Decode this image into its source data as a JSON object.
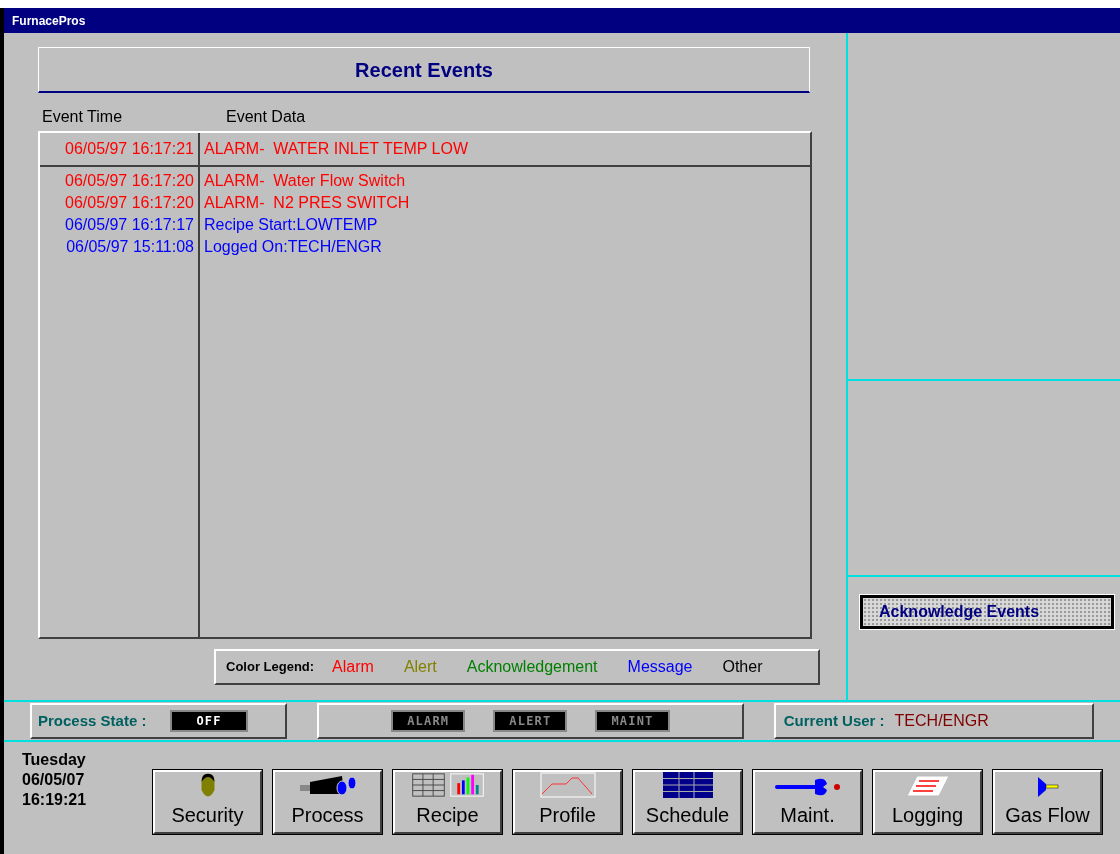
{
  "window": {
    "title": "FurnacePros"
  },
  "events_panel": {
    "title": "Recent Events",
    "columns": [
      "Event Time",
      "Event Data"
    ],
    "latest": {
      "time": "06/05/97 16:17:21",
      "data": "ALARM-  WATER INLET TEMP LOW",
      "color": "#ff0000"
    },
    "events": [
      {
        "time": "06/05/97 16:17:20",
        "data": "ALARM-  Water Flow Switch",
        "color": "#ff0000"
      },
      {
        "time": "06/05/97 16:17:20",
        "data": "ALARM-  N2 PRES SWITCH",
        "color": "#ff0000"
      },
      {
        "time": "06/05/97 16:17:17",
        "data": "Recipe Start:LOWTEMP",
        "color": "#0000ff"
      },
      {
        "time": "06/05/97 15:11:08",
        "data": "Logged On:TECH/ENGR",
        "color": "#0000ff"
      }
    ]
  },
  "legend": {
    "label": "Color Legend:",
    "items": [
      {
        "label": "Alarm",
        "color": "#ff0000"
      },
      {
        "label": "Alert",
        "color": "#808000"
      },
      {
        "label": "Acknowledgement",
        "color": "#008000"
      },
      {
        "label": "Message",
        "color": "#0000ff"
      },
      {
        "label": "Other",
        "color": "#000000"
      }
    ]
  },
  "acknowledge_button": "Acknowledge Events",
  "status": {
    "process_label": "Process State :",
    "process_state": {
      "label": "OFF",
      "active": true
    },
    "indicators": [
      {
        "label": "ALARM",
        "active": false
      },
      {
        "label": "ALERT",
        "active": false
      },
      {
        "label": "MAINT",
        "active": false
      }
    ],
    "user_label": "Current User :",
    "user": "TECH/ENGR"
  },
  "clock": {
    "day": "Tuesday",
    "date": "06/05/07",
    "time": "16:19:21"
  },
  "nav": [
    {
      "label": "Security",
      "kind": "person"
    },
    {
      "label": "Process",
      "kind": "binoculars"
    },
    {
      "label": "Recipe",
      "kind": "recipe"
    },
    {
      "label": "Profile",
      "kind": "profile"
    },
    {
      "label": "Schedule",
      "kind": "schedule"
    },
    {
      "label": "Maint.",
      "kind": "wrench"
    },
    {
      "label": "Logging",
      "kind": "paper"
    },
    {
      "label": "Gas Flow",
      "kind": "valve"
    }
  ]
}
